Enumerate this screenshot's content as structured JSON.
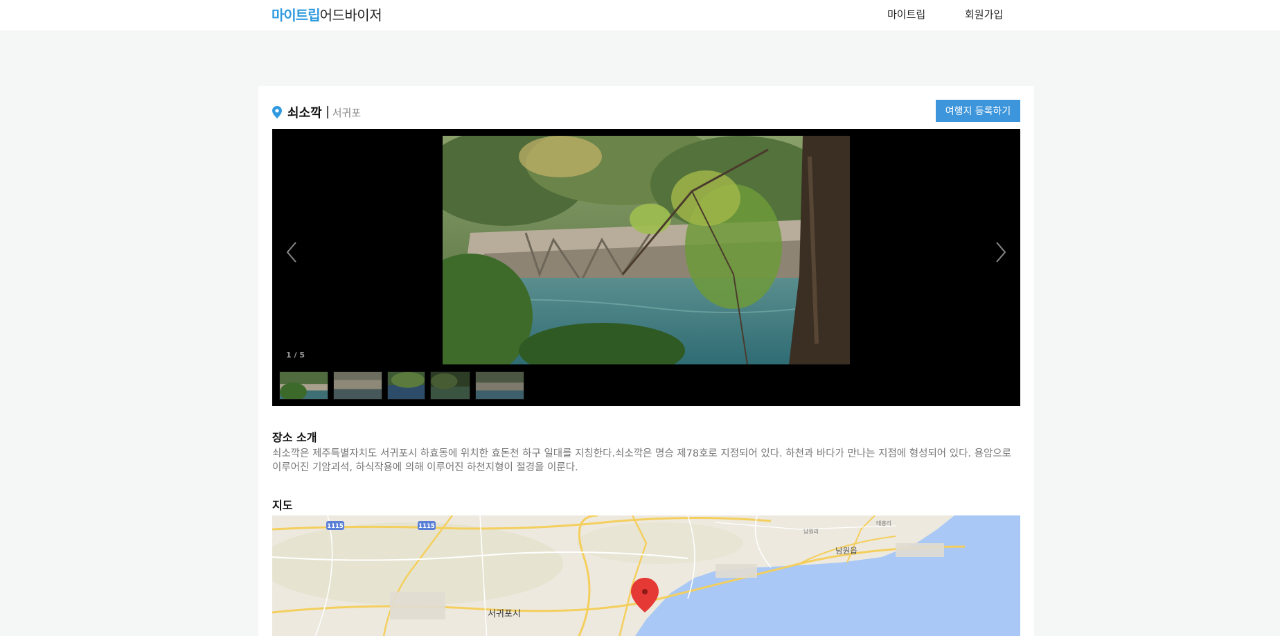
{
  "header": {
    "logo_brand": "마이트립",
    "logo_rest": "어드바이저",
    "nav": [
      "마이트립",
      "회원가입"
    ]
  },
  "place": {
    "name": "쇠소깍",
    "region": "서귀포",
    "register_button": "여행지 등록하기"
  },
  "gallery": {
    "counter": "1 / 5",
    "thumb_count": 5
  },
  "intro": {
    "title": "장소 소개",
    "text": "쇠소깍은 제주특별자치도 서귀포시 하효동에 위치한 효돈천 하구 일대를 지칭한다.쇠소깍은 명승 제78호로 지정되어 있다. 하천과 바다가 만나는 지점에 형성되어 있다. 용암으로 이루어진 기암괴석, 하식작용에 의해 이루어진 하천지형이 절경을 이룬다."
  },
  "map": {
    "title": "지도",
    "road_badges": [
      "1115",
      "1115"
    ],
    "labels": {
      "city": "서귀포시",
      "town": "남원읍",
      "village1": "남원리",
      "village2": "태흥리"
    }
  },
  "colors": {
    "brand": "#2f9ae0",
    "button": "#3d95db",
    "sea": "#a9c8f5",
    "marker": "#e53935"
  }
}
